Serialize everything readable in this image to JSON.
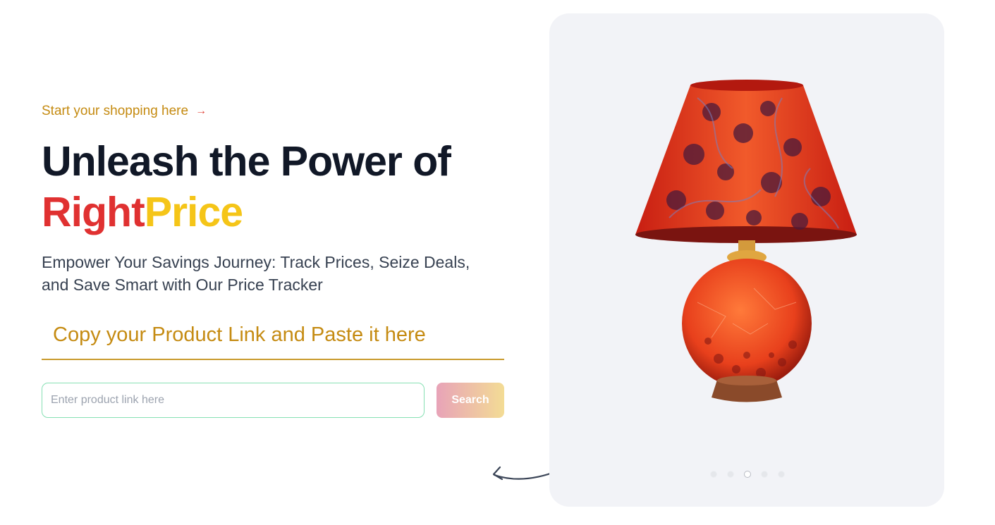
{
  "hero": {
    "kicker": "Start your shopping here",
    "headline_line1": "Unleash the Power of",
    "brand_part1": "Right",
    "brand_part2": "Price",
    "subtitle": "Empower Your Savings Journey: Track Prices, Seize Deals, and Save Smart with Our Price Tracker",
    "cta_text": "Copy your Product Link and Paste it here"
  },
  "search": {
    "placeholder": "Enter product link here",
    "value": "",
    "button_label": "Search"
  },
  "carousel": {
    "image_alt": "table-lamp",
    "slide_count": 5,
    "active_index": 2
  },
  "colors": {
    "accent": "#c58b12",
    "brand_right": "#e03131",
    "brand_price": "#f5c518",
    "heading": "#111827",
    "input_border": "#86e0b3"
  },
  "icons": {
    "kicker_arrow": "arrow-right-icon",
    "curved_arrow": "curved-arrow-icon"
  }
}
